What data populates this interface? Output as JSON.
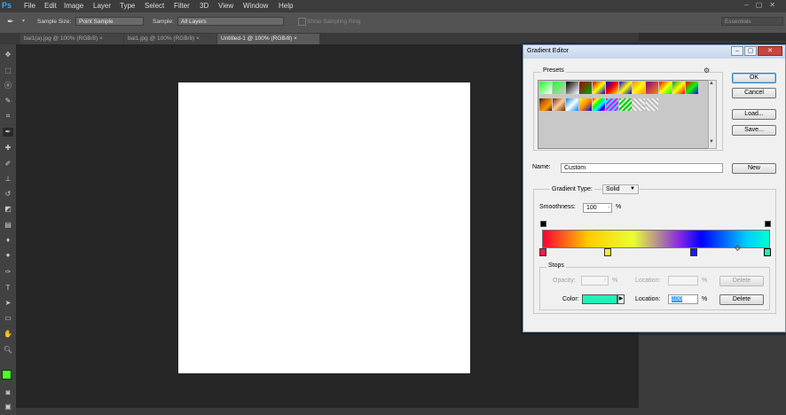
{
  "app": {
    "logo": "Ps"
  },
  "menu": [
    "File",
    "Edit",
    "Image",
    "Layer",
    "Type",
    "Select",
    "Filter",
    "3D",
    "View",
    "Window",
    "Help"
  ],
  "options": {
    "sample_size_label": "Sample Size:",
    "sample_size_value": "Point Sample",
    "sample_label": "Sample:",
    "sample_value": "All Layers",
    "show_ring_label": "Show Sampling Ring",
    "workspace": "Essentials"
  },
  "tabs": [
    {
      "label": "bai1(a).jpg @ 100% (RGB/8)",
      "active": false
    },
    {
      "label": "bai1.jpg @ 100% (RGB/8)",
      "active": false
    },
    {
      "label": "Untitled-1 @ 100% (RGB/8)",
      "active": true
    }
  ],
  "colors": {
    "foreground": "#4cff2a",
    "background": "#ffffff",
    "stop_color": "#22f0b8"
  },
  "dialog": {
    "title": "Gradient Editor",
    "presets_label": "Presets",
    "ok_label": "OK",
    "cancel_label": "Cancel",
    "load_label": "Load...",
    "save_label": "Save...",
    "name_label": "Name:",
    "name_value": "Custom",
    "new_label": "New",
    "gradient_type_label": "Gradient Type:",
    "gradient_type_value": "Solid",
    "smoothness_label": "Smoothness:",
    "smoothness_value": "100",
    "smoothness_unit": "%",
    "stops_label": "Stops",
    "opacity_label": "Opacity:",
    "opacity_unit": "%",
    "location_label": "Location:",
    "location_unit": "%",
    "delete_label": "Delete",
    "color_label": "Color:",
    "color_location_label": "Location:",
    "color_location_value": "100",
    "color_location_unit": "%",
    "color_delete_label": "Delete"
  }
}
